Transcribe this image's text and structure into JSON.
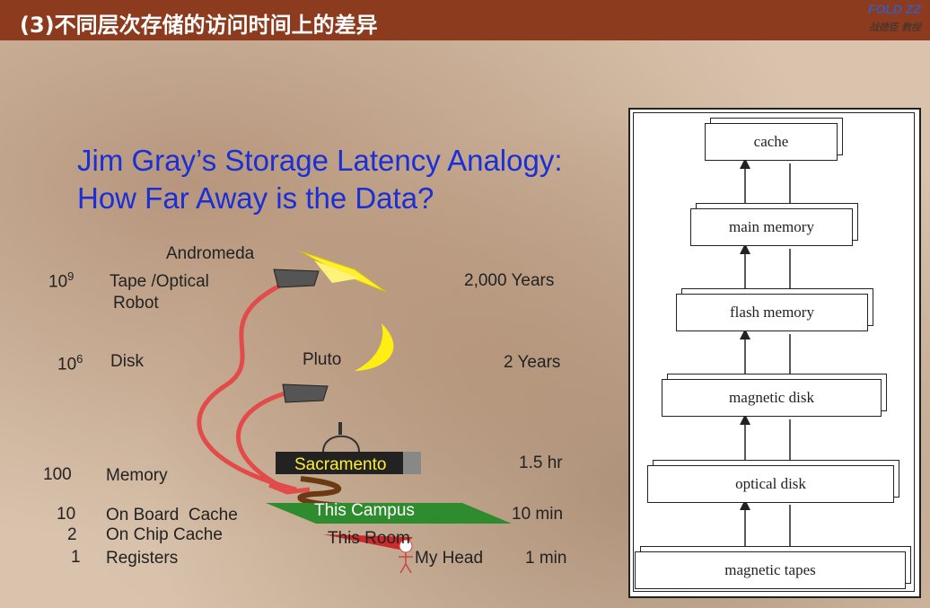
{
  "header": {
    "title": "(3)不同层次存储的访问时间上的差异",
    "logo_mark": "FOLD ZZ",
    "logo_text": "战德臣 教授"
  },
  "slide": {
    "title_line1": "Jim Gray’s Storage Latency Analogy:",
    "title_line2": "How Far Away is the Data?"
  },
  "analogy": {
    "andromeda": "Andromeda",
    "pluto": "Pluto",
    "sacramento": "Sacramento",
    "this_campus": "This Campus",
    "this_room": "This Room",
    "my_head": "My Head",
    "rows": [
      {
        "base": "10",
        "exp": "9",
        "name_line1": "Tape /Optical",
        "name_line2": "Robot",
        "time": "2,000 Years"
      },
      {
        "base": "10",
        "exp": "6",
        "name_line1": "Disk",
        "name_line2": "",
        "time": "2 Years"
      },
      {
        "base": "100",
        "exp": "",
        "name_line1": "Memory",
        "name_line2": "",
        "time": "1.5 hr"
      },
      {
        "base": "10",
        "exp": "",
        "name_line1": "On Board  Cache",
        "name_line2": "",
        "time": "10 min"
      },
      {
        "base": "2",
        "exp": "",
        "name_line1": "On Chip Cache",
        "name_line2": "",
        "time": ""
      },
      {
        "base": "1",
        "exp": "",
        "name_line1": "Registers",
        "name_line2": "",
        "time": "1 min"
      }
    ]
  },
  "hierarchy": {
    "levels": [
      "cache",
      "main memory",
      "flash memory",
      "magnetic disk",
      "optical disk",
      "magnetic tapes"
    ]
  }
}
